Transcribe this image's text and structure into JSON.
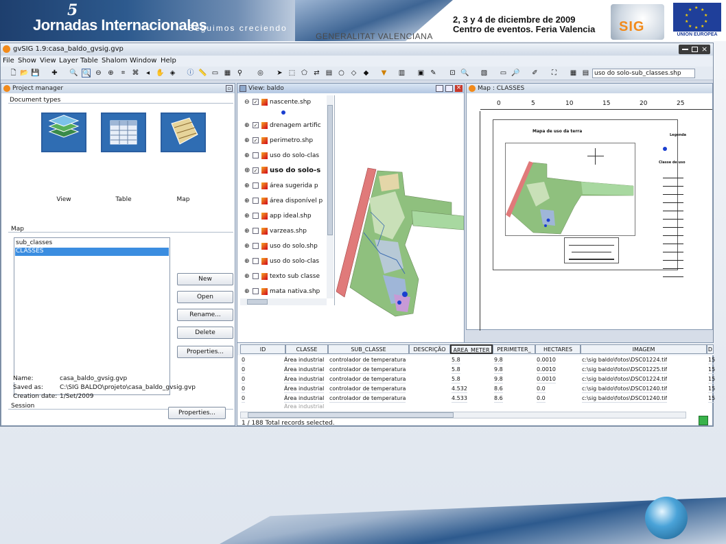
{
  "banner": {
    "five": "5",
    "title": "Jornadas Internacionales",
    "subtitle": "Seguimos creciendo",
    "generalitat": "GENERALITAT VALENCIANA",
    "date_line1": "2, 3 y 4 de diciembre de 2009",
    "date_line2": "Centro de eventos. Feria Valencia",
    "gvsig": "SIG",
    "eu": "UNIÓN EUROPEA"
  },
  "app": {
    "title": "gvSIG 1.9:casa_baldo_gvsig.gvp",
    "menus": [
      "File",
      "Show",
      "View",
      "Layer",
      "Table",
      "Shalom",
      "Window",
      "Help"
    ],
    "layer_combo": "uso do solo-sub_classes.shp"
  },
  "project_manager": {
    "title": "Project manager",
    "document_types_label": "Document types",
    "doc_types": [
      "View",
      "Table",
      "Map"
    ],
    "map_label": "Map",
    "maps": [
      "sub_classes",
      "CLASSES"
    ],
    "selected_map": "CLASSES",
    "buttons": {
      "new": "New",
      "open": "Open",
      "rename": "Rename...",
      "delete": "Delete",
      "properties": "Properties..."
    },
    "session_label": "Session",
    "session": {
      "name_label": "Name:",
      "name": "casa_baldo_gvsig.gvp",
      "saved_label": "Saved as:",
      "saved": "C:\\SIG BALDO\\projeto\\casa_baldo_gvsig.gvp",
      "created_label": "Creation date:",
      "created": "1/Set/2009"
    },
    "session_properties": "Properties..."
  },
  "view": {
    "title": "View: baldo",
    "layers": [
      {
        "name": "nascente.shp",
        "checked": true
      },
      {
        "name": "drenagem artific",
        "checked": true
      },
      {
        "name": "perimetro.shp",
        "checked": true
      },
      {
        "name": "uso do solo-clas",
        "checked": false
      },
      {
        "name": "uso do solo-s",
        "checked": true
      },
      {
        "name": "área sugerida p",
        "checked": false
      },
      {
        "name": "área disponível p",
        "checked": false
      },
      {
        "name": "app ideal.shp",
        "checked": false
      },
      {
        "name": "varzeas.shp",
        "checked": false
      },
      {
        "name": "uso do solo.shp",
        "checked": false
      },
      {
        "name": "uso do solo-clas",
        "checked": false
      },
      {
        "name": "texto sub classe",
        "checked": false
      },
      {
        "name": "mata nativa.shp",
        "checked": false
      }
    ]
  },
  "map_window": {
    "title": "Map : CLASSES",
    "ruler": [
      "0",
      "5",
      "10",
      "15",
      "20",
      "25"
    ],
    "map_title": "Mapa de uso da terra",
    "legend_title": "Legenda",
    "legend_sub": "Classe de uso"
  },
  "table": {
    "columns": [
      "ID",
      "CLASSE",
      "SUB_CLASSE",
      "DESCRIÇÃO",
      "AREA_METER",
      "PERIMETER_",
      "HECTARES",
      "IMAGEM",
      "D"
    ],
    "rows": [
      [
        "0",
        "Área industrial",
        "controlador de temperatura",
        "",
        "5.8",
        "9.8",
        "0.0010",
        "c:\\sig baldo\\fotos\\DSC01224.tif",
        "15"
      ],
      [
        "0",
        "Área industrial",
        "controlador de temperatura",
        "",
        "5.8",
        "9.8",
        "0.0010",
        "c:\\sig baldo\\fotos\\DSC01225.tif",
        "15"
      ],
      [
        "0",
        "Área industrial",
        "controlador de temperatura",
        "",
        "5.8",
        "9.8",
        "0.0010",
        "c:\\sig baldo\\fotos\\DSC01224.tif",
        "15"
      ],
      [
        "0",
        "Área industrial",
        "controlador de temperatura",
        "",
        "4.532",
        "8.6",
        "0.0",
        "c:\\sig baldo\\fotos\\DSC01240.tif",
        "15"
      ],
      [
        "0",
        "Área industrial",
        "controlador de temperatura",
        "",
        "4.533",
        "8.6",
        "0.0",
        "c:\\sig baldo\\fotos\\DSC01240.tif",
        "15"
      ]
    ],
    "status": "1 / 188 Total records selected."
  }
}
